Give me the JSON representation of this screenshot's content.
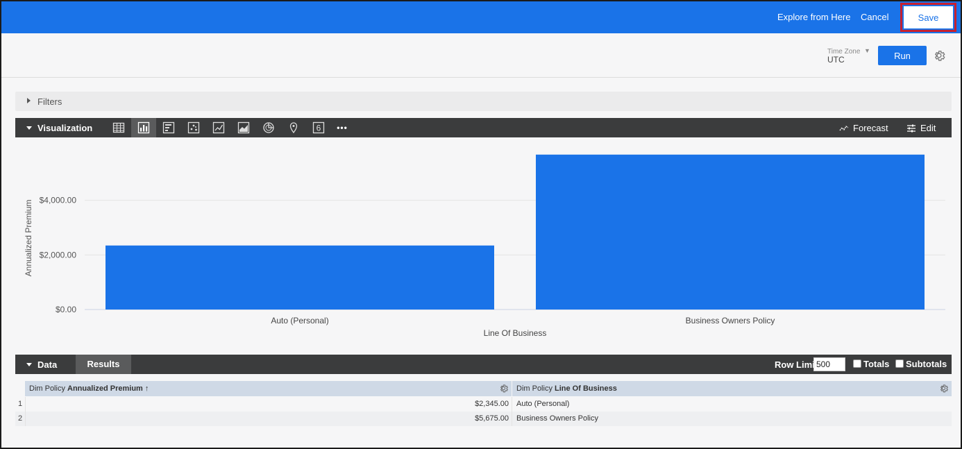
{
  "topbar": {
    "explore_label": "Explore from Here",
    "cancel_label": "Cancel",
    "save_label": "Save",
    "accent_color": "#1a73e8",
    "highlight_color": "#c62030"
  },
  "subbar": {
    "timezone_label": "Time Zone",
    "timezone_value": "UTC",
    "run_label": "Run"
  },
  "filters": {
    "label": "Filters"
  },
  "visualization": {
    "label": "Visualization",
    "icons": [
      "table-icon",
      "bar-chart-icon",
      "column-chart-icon",
      "scatter-icon",
      "line-chart-icon",
      "area-chart-icon",
      "pie-chart-icon",
      "map-pin-icon",
      "single-value-icon",
      "more-icon"
    ],
    "single_value_glyph": "6",
    "more_glyph": "•••",
    "active_icon": "bar-chart-icon",
    "forecast_label": "Forecast",
    "edit_label": "Edit"
  },
  "chart_data": {
    "type": "bar",
    "categories": [
      "Auto (Personal)",
      "Business Owners Policy"
    ],
    "values": [
      2345.0,
      5675.0
    ],
    "xlabel": "Line Of Business",
    "ylabel": "Annualized Premium",
    "yticks": [
      0,
      2000,
      4000
    ],
    "ytick_labels": [
      "$0.00",
      "$2,000.00",
      "$4,000.00"
    ],
    "ylim": [
      0,
      6000
    ],
    "bar_color": "#1a73e8",
    "grid": true
  },
  "data_section": {
    "label": "Data",
    "results_tab": "Results",
    "row_limit_label": "Row Limit",
    "row_limit_value": "500",
    "totals_label": "Totals",
    "subtotals_label": "Subtotals"
  },
  "table": {
    "columns": [
      {
        "prefix": "Dim Policy",
        "name": "Annualized Premium",
        "sort": "↑"
      },
      {
        "prefix": "Dim Policy",
        "name": "Line Of Business",
        "sort": ""
      }
    ],
    "rows": [
      {
        "index": "1",
        "premium": "$2,345.00",
        "lob": "Auto (Personal)"
      },
      {
        "index": "2",
        "premium": "$5,675.00",
        "lob": "Business Owners Policy"
      }
    ]
  }
}
